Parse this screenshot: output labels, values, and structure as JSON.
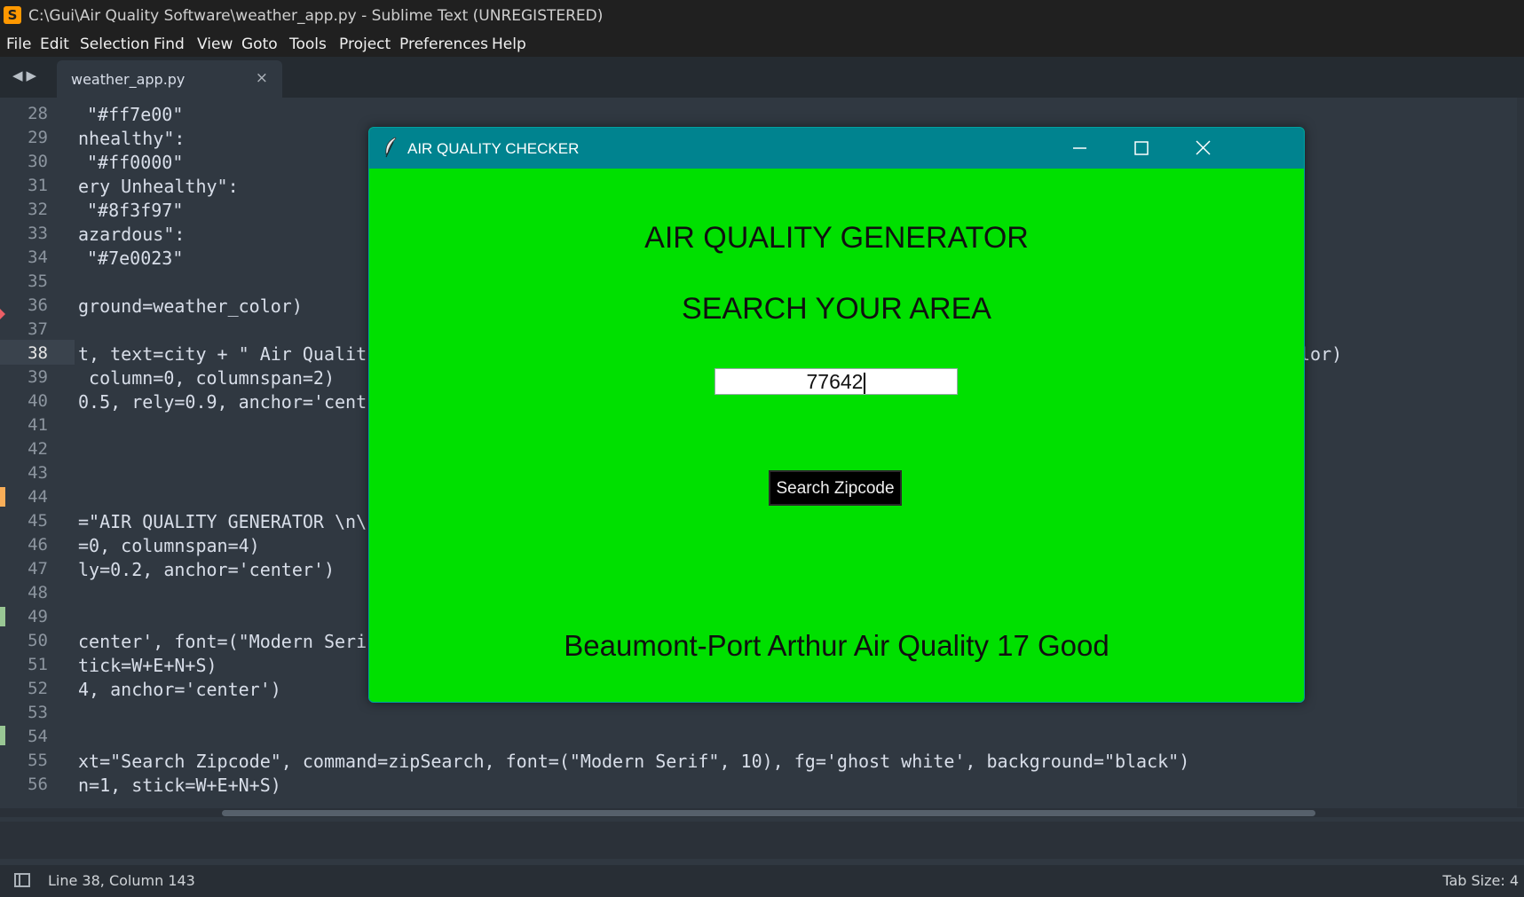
{
  "window": {
    "title": "C:\\Gui\\Air Quality Software\\weather_app.py - Sublime Text (UNREGISTERED)"
  },
  "menu": [
    "File",
    "Edit",
    "Selection",
    "Find",
    "View",
    "Goto",
    "Tools",
    "Project",
    "Preferences",
    "Help"
  ],
  "tab": {
    "name": "weather_app.py",
    "close": "×"
  },
  "gutter": {
    "lines": [
      "28",
      "29",
      "30",
      "31",
      "32",
      "33",
      "34",
      "35",
      "36",
      "37",
      "38",
      "39",
      "40",
      "41",
      "42",
      "43",
      "44",
      "45",
      "46",
      "47",
      "48",
      "49",
      "50",
      "51",
      "52",
      "53",
      "54",
      "55",
      "56"
    ]
  },
  "code": {
    "l28": "\"#ff7e00\"",
    "l29": "nhealthy\":",
    "l30": "\"#ff0000\"",
    "l31": "ery Unhealthy\":",
    "l32": "\"#8f3f97\"",
    "l33": "azardous\":",
    "l34": "\"#7e0023\"",
    "l36": "ground=weather_color)",
    "l38a": "t, text=city + \" Air Qualit",
    "l38b": "lor)",
    "l39": " column=0, columnspan=2)",
    "l40": "0.5, rely=0.9, anchor='cent",
    "l45": "=\"AIR QUALITY GENERATOR \\n\\",
    "l46": "=0, columnspan=4)",
    "l47": "ly=0.2, anchor='center')",
    "l50": "center', font=(\"Modern Seri",
    "l51": "tick=W+E+N+S)",
    "l52": "4, anchor='center')",
    "l55": "xt=\"Search Zipcode\", command=zipSearch, font=(\"Modern Serif\", 10), fg='ghost white', background=\"black\")",
    "l56": "n=1, stick=W+E+N+S)"
  },
  "status": {
    "position": "Line 38, Column 143",
    "tab_size": "Tab Size: 4"
  },
  "tk": {
    "title": "AIR QUALITY CHECKER",
    "heading": "AIR QUALITY GENERATOR",
    "subheading": "SEARCH YOUR AREA",
    "zip_value": "77642",
    "button": "Search Zipcode",
    "result": "Beaumont-Port Arthur Air Quality 17 Good",
    "bg_color": "#00e000"
  }
}
